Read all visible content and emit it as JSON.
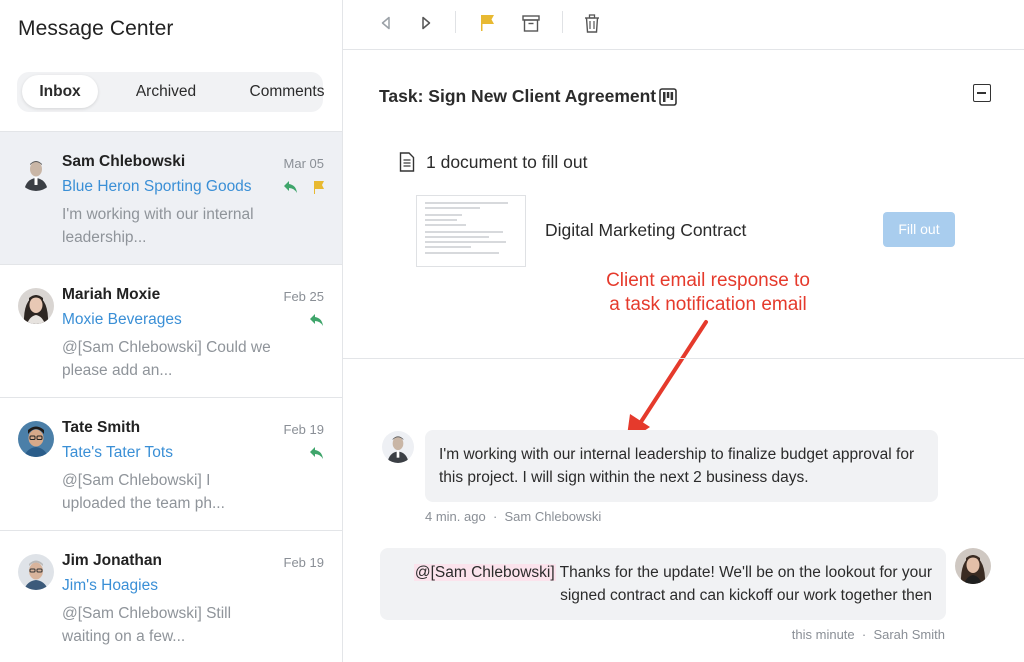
{
  "app": {
    "title": "Message Center"
  },
  "tabs": [
    {
      "label": "Inbox",
      "active": true
    },
    {
      "label": "Archived",
      "active": false
    },
    {
      "label": "Comments",
      "active": false
    }
  ],
  "messages": [
    {
      "sender": "Sam Chlebowski",
      "date": "Mar 05",
      "company": "Blue Heron Sporting Goods",
      "preview": "I'm working with our internal leadership...",
      "icons": [
        "reply-icon",
        "flag-icon"
      ],
      "selected": true
    },
    {
      "sender": "Mariah Moxie",
      "date": "Feb 25",
      "company": "Moxie Beverages",
      "preview": "@[Sam Chlebowski] Could we please add an...",
      "icons": [
        "reply-icon"
      ],
      "selected": false
    },
    {
      "sender": "Tate Smith",
      "date": "Feb 19",
      "company": "Tate's Tater Tots",
      "preview": "@[Sam Chlebowski] I uploaded the team ph...",
      "icons": [
        "reply-icon"
      ],
      "selected": false
    },
    {
      "sender": "Jim Jonathan",
      "date": "Feb 19",
      "company": "Jim's Hoagies",
      "preview": "@[Sam Chlebowski] Still waiting on a few...",
      "icons": [],
      "selected": false
    }
  ],
  "toolbar": {
    "icons": [
      "prev-icon",
      "next-icon",
      "flag-icon",
      "archive-icon",
      "trash-icon"
    ],
    "flag_color": "#e8b931"
  },
  "task": {
    "title": "Task: Sign New Client Agreement",
    "doc_count": "1 document to fill out",
    "document_name": "Digital Marketing Contract",
    "fill_button": "Fill out"
  },
  "annotation": {
    "line1": "Client email response to",
    "line2": "a task notification email",
    "color": "#e53a2c"
  },
  "comments": [
    {
      "text": "I'm working with our internal leadership to finalize budget approval for this project. I will sign within the next 2 business days.",
      "time": "4 min. ago",
      "author": "Sam Chlebowski"
    },
    {
      "mention": "@[Sam Chlebowski]",
      "text": " Thanks for the update! We'll be on the lookout for your signed contract and can kickoff our work together then",
      "time": "this minute",
      "author": "Sarah Smith"
    }
  ],
  "colors": {
    "accent": "#3a8fd6",
    "reply": "#3fa56b",
    "button": "#a9cdee"
  }
}
